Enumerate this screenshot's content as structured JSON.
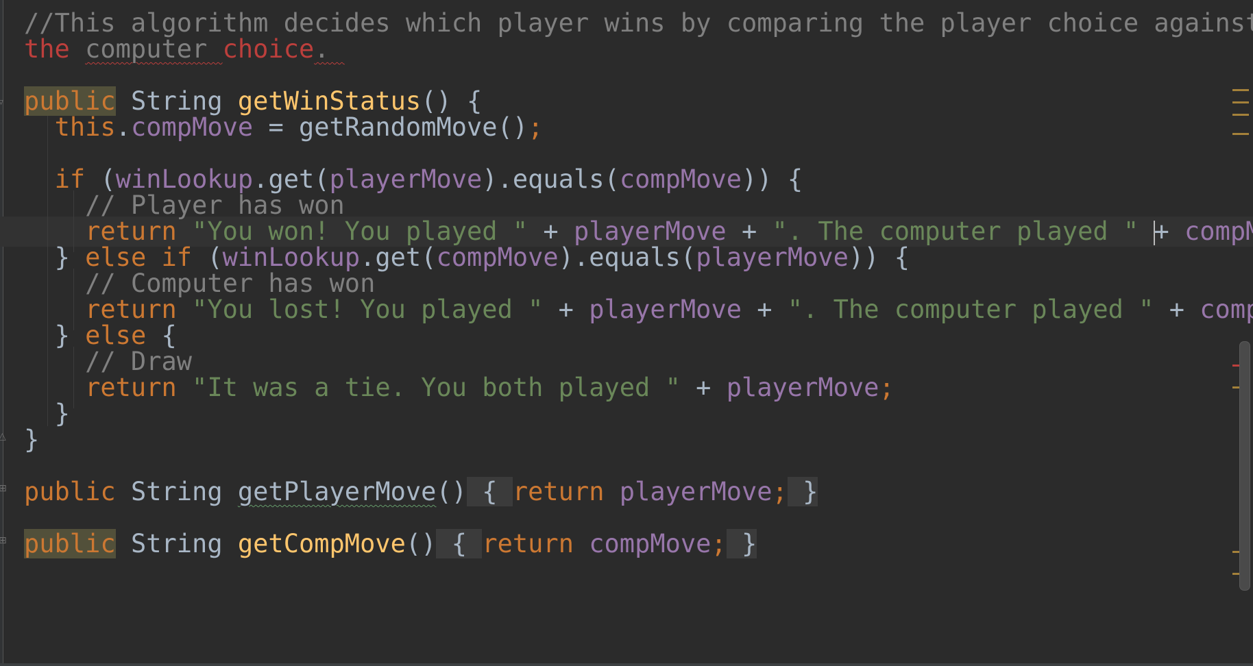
{
  "editor": {
    "language": "Java",
    "comment_lines": [
      "//This algorithm decides which player wins by comparing the player choice against",
      "the computer choice."
    ],
    "method1": {
      "modifier": "public",
      "return_type": "String",
      "name": "getWinStatus",
      "params": "()",
      "brace_open": "{"
    },
    "line_this": {
      "this": "this",
      "dot": ".",
      "field": "compMove",
      "assign": " = getRandomMove()",
      "semi": ";"
    },
    "if_line": {
      "kw": "if",
      "p1": "(",
      "lookup": "winLookup",
      "get": ".get(",
      "arg": "playerMove",
      "eq": ").equals(",
      "arg2": "compMove",
      "close": ")) {"
    },
    "comment_player": "// Player has won",
    "return_won": {
      "kw": "return",
      "str1": "\"You won! You played \"",
      "plus1": " + ",
      "var1": "playerMove",
      "plus2": " + ",
      "str2": "\". The computer played \"",
      "plus3": "+ ",
      "var2": "compMo"
    },
    "elseif_line": {
      "close": "} ",
      "kw": "else if",
      "p1": " (",
      "lookup": "winLookup",
      "get": ".get(",
      "arg": "compMove",
      "eq": ").equals(",
      "arg2": "playerMove",
      "close2": ")) {"
    },
    "comment_computer": "// Computer has won",
    "return_lost": {
      "kw": "return",
      "str1": "\"You lost! You played \"",
      "plus1": " + ",
      "var1": "playerMove",
      "plus2": " + ",
      "str2": "\". The computer played \"",
      "plus3": " + ",
      "var2": "compM"
    },
    "else_line": {
      "close": "} ",
      "kw": "else",
      "open": " {"
    },
    "comment_draw": "// Draw",
    "return_tie": {
      "kw": "return",
      "str1": "\"It was a tie. You both played \"",
      "plus1": " + ",
      "var1": "playerMove",
      "semi": ";"
    },
    "brace_inner_close": "}",
    "brace_method_close": "}",
    "method2": {
      "modifier": "public",
      "return_type": "String",
      "name": "getPlayerMove",
      "params": "()",
      "body_open": " { ",
      "ret": "return",
      "field": "playerMove",
      "semi": ";",
      "body_close": " }"
    },
    "method3": {
      "modifier": "public",
      "return_type": "String",
      "name": "getCompMove",
      "params": "()",
      "body_open": " { ",
      "ret": "return",
      "field": "compMove",
      "semi": ";",
      "body_close": " }"
    },
    "colors": {
      "background": "#2b2b2b",
      "keyword": "#cc7832",
      "string": "#6a8759",
      "field": "#9876aa",
      "method": "#ffc66d",
      "comment": "#808080",
      "comment_error": "#bc3f3c"
    }
  }
}
